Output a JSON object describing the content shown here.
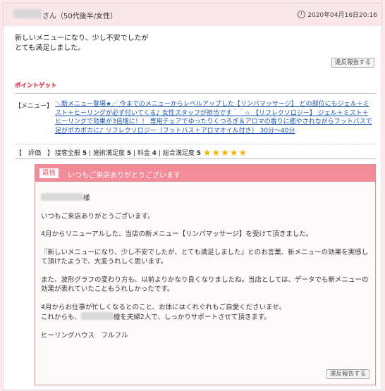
{
  "header": {
    "user_suffix": "さん（50代後半/女性）",
    "date": "2020年04月16日20:16"
  },
  "review": {
    "lines": [
      "新しいメニューになり、少し不安でしたが",
      "とても満足しました。"
    ],
    "report_label": "違反報告する"
  },
  "point_label": "ポイントゲット",
  "menu": {
    "label": "【メニュー】",
    "link_text": "＼新メニュー登場★／ 今までのメニューからレベルアップした【リンパマッサージ】 どの部位にもジェル＋ミスト＋ヒーリングが必ず付いてくる♪ 女性スタッフが担当です＾＾☆ 【リフレクソロジー】 ジェル＋ミスト＋ヒーリングで効果が3倍増に！！ 専用チェアでゆったりくつろぎ＆アロマの香りに癒やされながらフットバスで足がポカポカに♪ リフレクソロジー（フットバス＋アロマオイル付き） 30分～40分"
  },
  "rating": {
    "label": "【　評価　】",
    "service_label": "接客全般",
    "service": "5",
    "treatment_label": "施術満足度",
    "treatment": "5",
    "price_label": "料金",
    "price": "4",
    "overall_label": "総合満足度",
    "overall": "5",
    "stars": "★★★★★",
    "star_color": "#f2b400"
  },
  "reply": {
    "badge": "返信",
    "title": "いつもご来店ありがとうございます",
    "salutation_suffix": "様",
    "p1": "いつもご来店ありがとうございます。",
    "p2": "4月からリニューアルした、当店の新メニュー【リンパマッサージ】を受けて頂きました。",
    "p3": "『新しいメニューになり、少し不安でしたが、とても満足しました』とのお言葉、新メニューの効果を実感して頂けたようで、大変うれしく思います。",
    "p4": "また、波形グラフの変わり方も、以前よりかなり良くなりましたね。当店としては、データでも新メニューの効果が表れていたこともうれしかったです。",
    "p5a": "4月からお仕事が忙しくなるとのこと、お体にはくれぐれもご自愛くださいませ。",
    "p5b_pre": "これからも、",
    "p5b_post": "様を夫婦2人で、しっかりサポートさせて頂きます。",
    "signature": "ヒーリングハウス　フルフル",
    "report_label": "違反報告する"
  },
  "colors": {
    "accent_pink": "#f28c98",
    "point_red": "#e2001a",
    "link_blue": "#1a56b0"
  }
}
